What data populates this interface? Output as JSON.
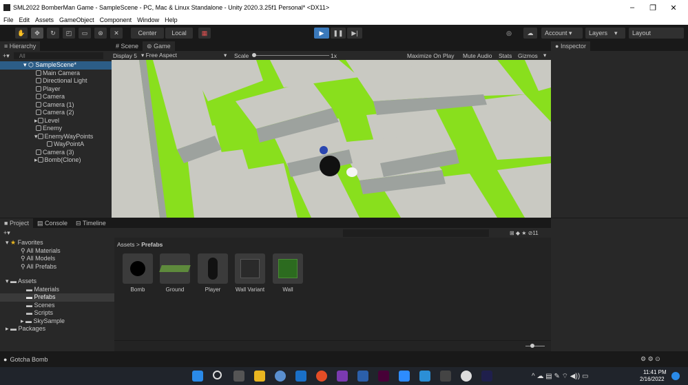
{
  "window": {
    "title": "SML2022 BomberMan Game - SampleScene - PC, Mac & Linux Standalone - Unity 2020.3.25f1 Personal* <DX11>",
    "controls": [
      "–",
      "❐",
      "✕"
    ]
  },
  "menu": [
    "File",
    "Edit",
    "Assets",
    "GameObject",
    "Component",
    "Window",
    "Help"
  ],
  "toolbar": {
    "center_label": "Center",
    "local_label": "Local",
    "account_label": "Account",
    "layers_label": "Layers",
    "layout_label": "Layout"
  },
  "hierarchy": {
    "tab_label": "Hierarchy",
    "search_placeholder": "All",
    "scene_name": "SampleScene*",
    "items": [
      {
        "label": "Main Camera",
        "indent": 1
      },
      {
        "label": "Directional Light",
        "indent": 1
      },
      {
        "label": "Player",
        "indent": 1
      },
      {
        "label": "Camera",
        "indent": 1
      },
      {
        "label": "Camera (1)",
        "indent": 1
      },
      {
        "label": "Camera (2)",
        "indent": 1
      },
      {
        "label": "Level",
        "indent": 1,
        "collapsed": true
      },
      {
        "label": "Enemy",
        "indent": 1
      },
      {
        "label": "EnemyWayPoints",
        "indent": 1,
        "expanded": true
      },
      {
        "label": "WayPointA",
        "indent": 2
      },
      {
        "label": "Camera (3)",
        "indent": 1
      },
      {
        "label": "Bomb(Clone)",
        "indent": 1,
        "collapsed": true
      }
    ]
  },
  "game_view": {
    "tabs": [
      "Scene",
      "Game"
    ],
    "active_tab": "Game",
    "display": "Display 5",
    "aspect": "Free Aspect",
    "scale_label": "Scale",
    "scale_value": "1x",
    "options": [
      "Maximize On Play",
      "Mute Audio",
      "Stats",
      "Gizmos"
    ]
  },
  "inspector": {
    "tab_label": "Inspector"
  },
  "project": {
    "tabs": [
      "Project",
      "Console",
      "Timeline"
    ],
    "breadcrumb": [
      "Assets",
      "Prefabs"
    ],
    "hidden_count": "11",
    "favorites_label": "Favorites",
    "favorites": [
      "All Materials",
      "All Models",
      "All Prefabs"
    ],
    "assets_label": "Assets",
    "folders": [
      "Materials",
      "Prefabs",
      "Scenes",
      "Scripts",
      "SkySample"
    ],
    "selected_folder": "Prefabs",
    "packages_label": "Packages",
    "assets": [
      "Bomb",
      "Ground",
      "Player",
      "Wall Variant",
      "Wall"
    ]
  },
  "status": {
    "message": "Gotcha Bomb"
  },
  "taskbar": {
    "time": "11:41 PM",
    "date": "2/16/2022",
    "colors": {
      "accent": "#3a79bb",
      "grass": "#88e01a",
      "wall": "#d6d6cf"
    }
  }
}
